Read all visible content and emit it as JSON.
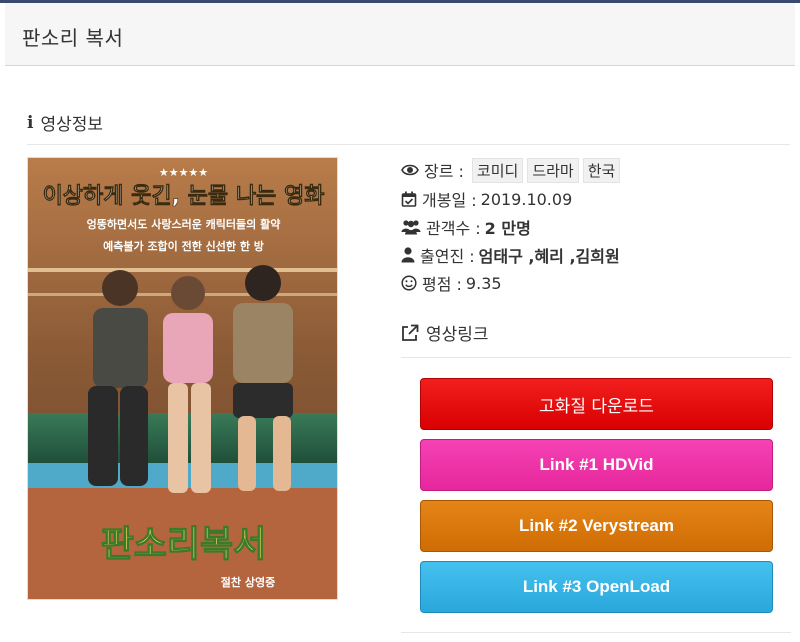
{
  "header": {
    "title": "판소리 복서"
  },
  "section": {
    "title": "영상정보"
  },
  "poster": {
    "rating_stars": "★★★★★",
    "tagline": "이상하게 웃긴, 눈물 나는 영화",
    "quote1": "엉뚱하면서도 사랑스러운 캐릭터들의 활약",
    "quote2": "예측불가 조합이 전한 신선한 한 방",
    "movie_title": "판소리복서",
    "bottom_text": "절찬 상영중"
  },
  "meta": {
    "genre_label": "장르 :",
    "genres": [
      "코미디",
      "드라마",
      "한국"
    ],
    "release_label": "개봉일 :",
    "release_value": "2019.10.09",
    "audience_label": "관객수 :",
    "audience_value": "2 만명",
    "cast_label": "출연진 :",
    "cast_value": "엄태구 ,혜리 ,김희원",
    "rating_label": "평점 :",
    "rating_value": "9.35"
  },
  "links": {
    "title": "영상링크",
    "buttons": [
      {
        "label": "고화질 다운로드",
        "color": "#e00b0b"
      },
      {
        "label": "Link #1 HDVid",
        "color": "#ee33a8"
      },
      {
        "label": "Link #2 Verystream",
        "color": "#d97a0e"
      },
      {
        "label": "Link #3 OpenLoad",
        "color": "#36b4e6"
      }
    ]
  }
}
